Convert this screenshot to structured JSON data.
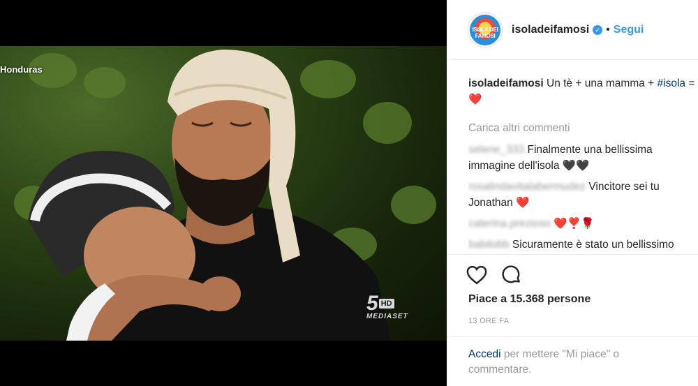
{
  "media": {
    "location_tag": "Honduras",
    "broadcaster": {
      "number": "5",
      "hd": "HD",
      "name": "MEDIASET"
    }
  },
  "header": {
    "avatar_text": "ISOLA DEI FAMOSI",
    "username": "isoladeifamosi",
    "verified_mark": "✓",
    "separator": "•",
    "follow_label": "Segui"
  },
  "caption": {
    "author": "isoladeifamosi",
    "text_before": "Un tè + una mamma +",
    "hashtag": "#isola",
    "text_after": "= ❤️"
  },
  "load_more_label": "Carica altri commenti",
  "comments": [
    {
      "author": "selene_333",
      "text": "Finalmente una bellissima immagine dell'isola 🖤🖤"
    },
    {
      "author": "rosalindavitalabermudez",
      "text": "Vincitore sei tu Jonathan ❤️"
    },
    {
      "author": "caterina.prezioso",
      "text": "❤️❣️🌹"
    },
    {
      "author": "babilobb",
      "text": "Sicuramente è stato un bellissimo momento.. La mamma è sempre la"
    }
  ],
  "actions": {
    "like_icon": "heart-icon",
    "comment_icon": "comment-icon"
  },
  "likes_text": "Piace a 15.368 persone",
  "timestamp": "13 ORE FA",
  "login_prompt": {
    "link": "Accedi",
    "text": " per mettere \"Mi piace\" o commentare."
  }
}
